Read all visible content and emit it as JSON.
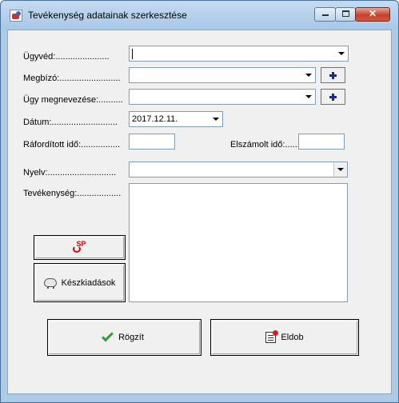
{
  "window": {
    "title": "Tevékenység adatainak szerkesztése",
    "close_glyph": "✕"
  },
  "form": {
    "ugyved_label": "Ügyvéd:......................",
    "ugyved_value": "",
    "megbizo_label": "Megbízó:.........................",
    "megbizo_value": "",
    "ugy_label": "Ügy megnevezése:..........",
    "ugy_value": "",
    "datum_label": "Dátum:...........................",
    "datum_value": "2017.12.11.",
    "raforditott_label": "Ráfordított idő:................",
    "raforditott_value": "",
    "elszamolt_label": "Elszámolt idő:......",
    "elszamolt_value": "",
    "nyelv_label": "Nyelv:............................",
    "nyelv_value": "",
    "tevekenyseg_label": "Tevékenység:..................",
    "tevekenyseg_value": ""
  },
  "buttons": {
    "sp_label": "SP",
    "keszkiadasok_label": "Készkiadások",
    "rogzit_label": "Rögzít",
    "eldob_label": "Eldob"
  },
  "icons": {
    "app": "app-icon",
    "add": "plus-icon",
    "sp": "sp-icon",
    "expenses": "piggy-bank-icon",
    "save": "checkmark-icon",
    "discard": "discard-icon"
  },
  "colors": {
    "titlebar": "#aecbe6",
    "close_button": "#c7402b",
    "plus": "#1b2a8a",
    "check": "#2e9e2e"
  }
}
